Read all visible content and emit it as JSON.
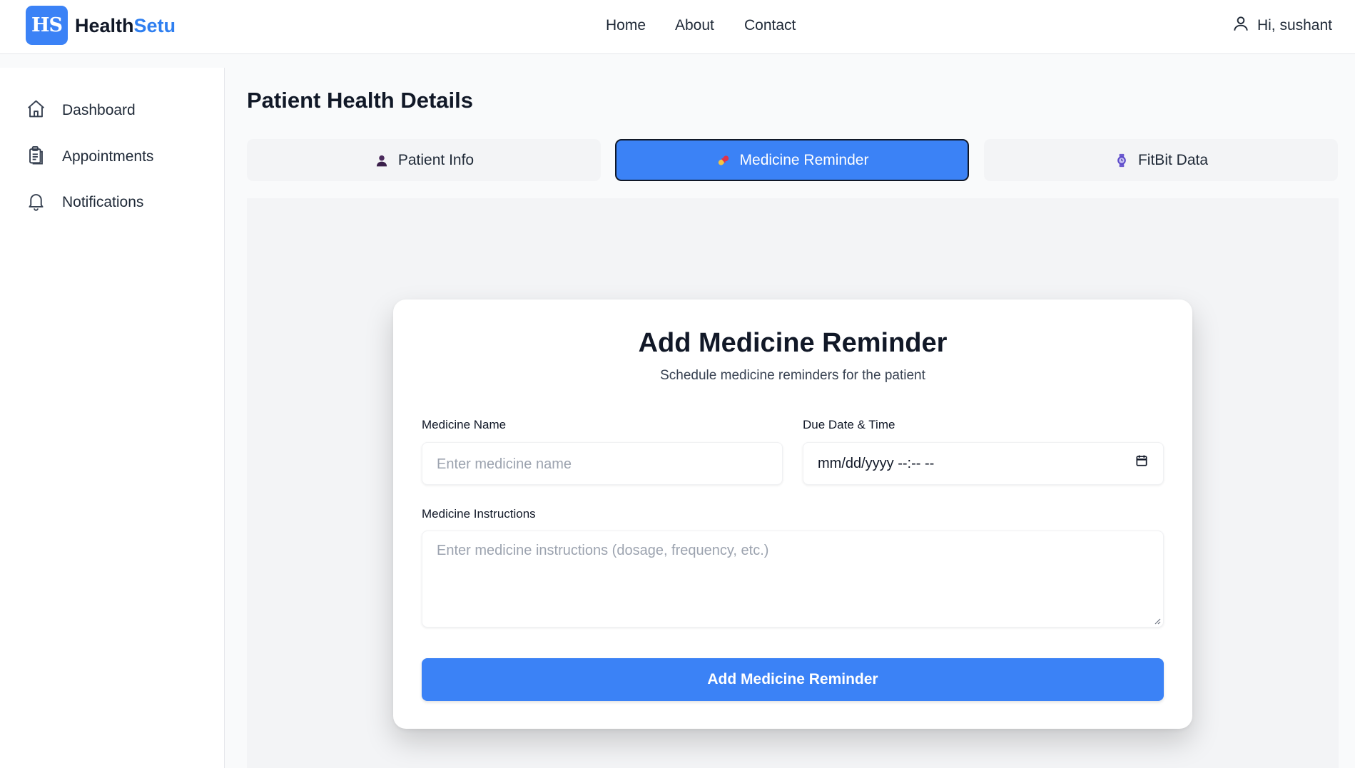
{
  "header": {
    "logo_badge": "HS",
    "brand_part1": "Health",
    "brand_part2": "Setu",
    "nav": [
      "Home",
      "About",
      "Contact"
    ],
    "user_greeting": "Hi, sushant",
    "icons": {
      "user": "user-icon"
    }
  },
  "sidebar": {
    "items": [
      {
        "label": "Dashboard",
        "icon": "home-icon"
      },
      {
        "label": "Appointments",
        "icon": "clipboard-icon"
      },
      {
        "label": "Notifications",
        "icon": "bell-icon"
      }
    ]
  },
  "main": {
    "title": "Patient Health Details",
    "tabs": [
      {
        "label": "Patient Info",
        "icon": "👤",
        "active": false
      },
      {
        "label": "Medicine Reminder",
        "icon": "💊",
        "active": true
      },
      {
        "label": "FitBit Data",
        "icon": "⌚",
        "active": false
      }
    ]
  },
  "form": {
    "title": "Add Medicine Reminder",
    "subtitle": "Schedule medicine reminders for the patient",
    "medicine_name_label": "Medicine Name",
    "medicine_name_placeholder": "Enter medicine name",
    "due_label": "Due Date & Time",
    "due_value": "mm/dd/yyyy --:-- --",
    "instructions_label": "Medicine Instructions",
    "instructions_placeholder": "Enter medicine instructions (dosage, frequency, etc.)",
    "submit_label": "Add Medicine Reminder"
  },
  "colors": {
    "primary": "#3b82f6",
    "brand_accent": "#2f7ff0",
    "background": "#f9fafb"
  }
}
